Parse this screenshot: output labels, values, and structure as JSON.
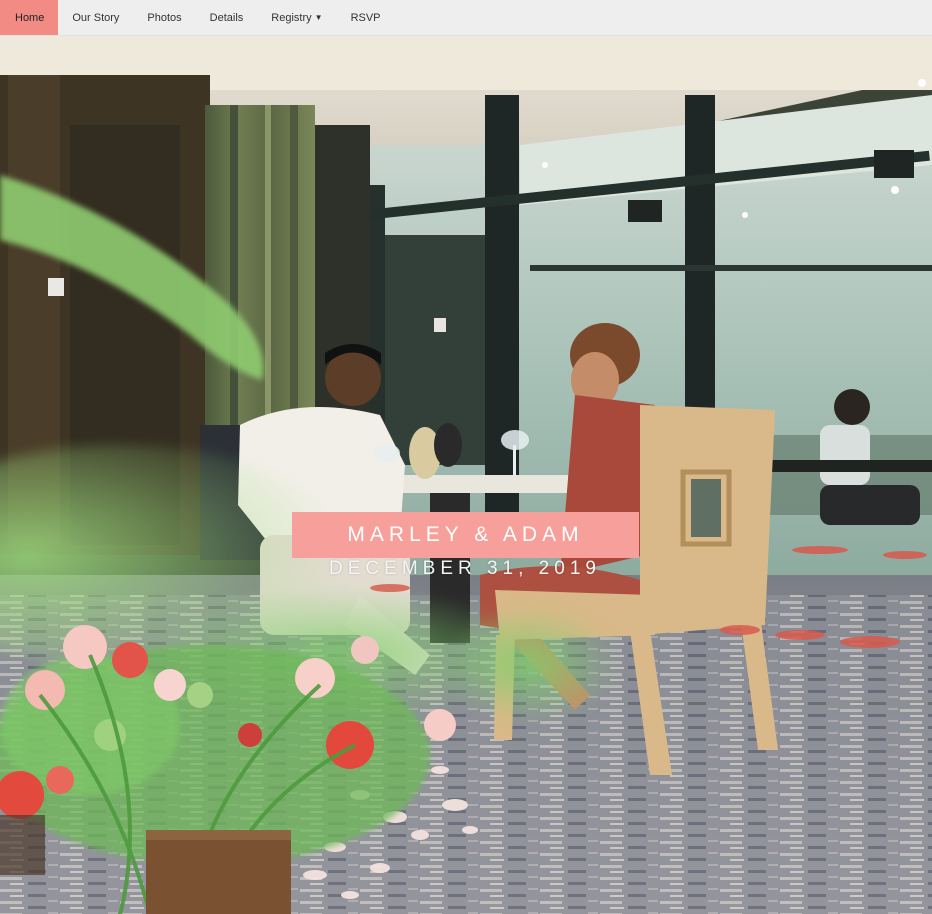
{
  "nav": {
    "items": [
      {
        "label": "Home",
        "active": true
      },
      {
        "label": "Our Story"
      },
      {
        "label": "Photos"
      },
      {
        "label": "Details"
      },
      {
        "label": "Registry",
        "has_dropdown": true
      },
      {
        "label": "RSVP"
      }
    ]
  },
  "hero": {
    "title": "MARLEY & ADAM",
    "date": "DECEMBER 31, 2019"
  },
  "colors": {
    "accent": "#f7a09b",
    "nav_active": "#f28b84",
    "nav_bg": "#eeeeee"
  }
}
